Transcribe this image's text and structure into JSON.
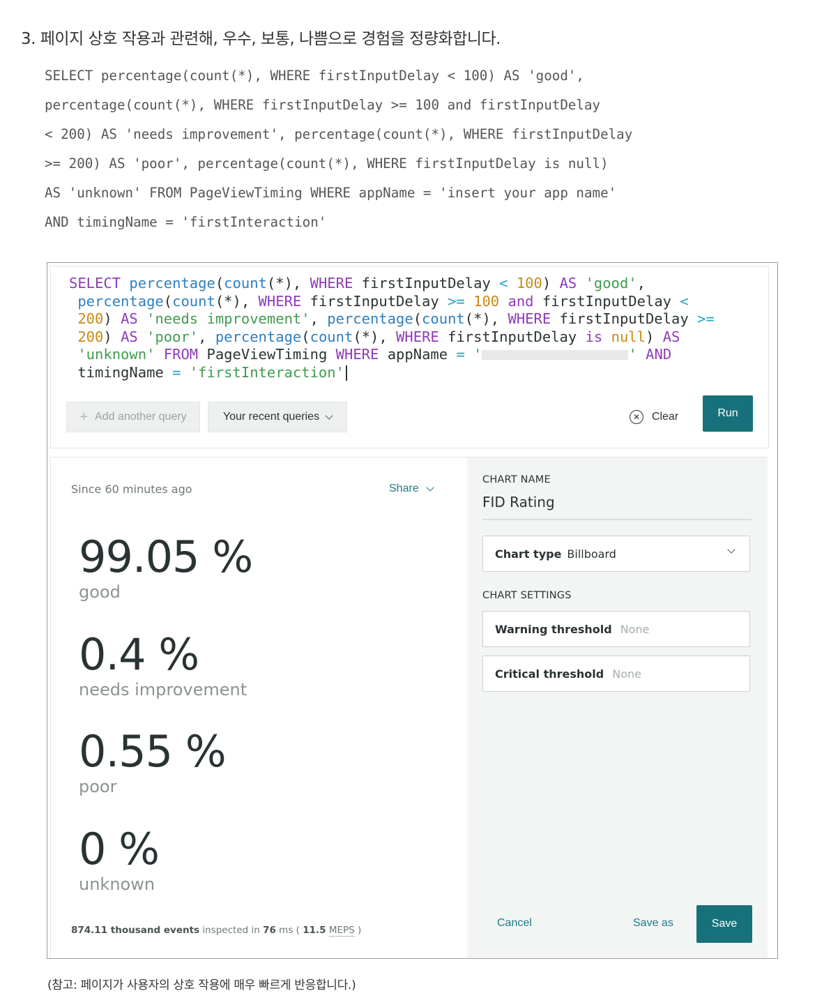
{
  "doc": {
    "step_number": "3.",
    "step_text": "페이지 상호 작용과 관련해, 우수, 보통, 나쁨으로 경험을 정량화합니다.",
    "code_lines": [
      "SELECT percentage(count(*), WHERE firstInputDelay < 100) AS 'good',",
      "percentage(count(*), WHERE firstInputDelay >= 100 and firstInputDelay",
      "< 200) AS 'needs improvement', percentage(count(*), WHERE firstInputDelay",
      ">= 200) AS 'poor', percentage(count(*), WHERE firstInputDelay is null)",
      "AS 'unknown' FROM PageViewTiming WHERE appName = 'insert your app name'",
      "AND timingName = 'firstInteraction'"
    ],
    "note": "(참고: 페이지가 사용자의 상호 작용에 매우 빠르게 반응합니다.)"
  },
  "editor": {
    "query_tokens": {
      "select": "SELECT",
      "percentage": "percentage",
      "count": "count",
      "star_paren": "(*),",
      "where": "WHERE",
      "fid": "firstInputDelay",
      "lt": "<",
      "gte": ">=",
      "n100": "100",
      "n200": "200",
      "as": "AS",
      "good": "'good'",
      "needs": "'needs improvement'",
      "poor": "'poor'",
      "is": "is",
      "null": "null",
      "unknown": "'unknown'",
      "from": "FROM",
      "pvt": "PageViewTiming",
      "appname": "appName",
      "eq": "=",
      "quote": "'",
      "and": "and",
      "AND": "AND",
      "timing": "timingName",
      "first_interaction": "'firstInteraction'"
    },
    "add_query_label": "Add another query",
    "recent_queries_label": "Your recent queries",
    "clear_label": "Clear",
    "run_label": "Run"
  },
  "results": {
    "since": "Since 60 minutes ago",
    "share_label": "Share",
    "metrics": [
      {
        "value": "99.05 %",
        "label": "good"
      },
      {
        "value": "0.4 %",
        "label": "needs improvement"
      },
      {
        "value": "0.55 %",
        "label": "poor"
      },
      {
        "value": "0 %",
        "label": "unknown"
      }
    ],
    "footer": {
      "events": "874.11 thousand events",
      "inspected": "inspected in",
      "ms": "76",
      "ms_unit": "ms (",
      "meps_value": "11.5",
      "meps": "MEPS",
      "close": ")"
    }
  },
  "settings": {
    "chart_name_label": "CHART NAME",
    "chart_name": "FID Rating",
    "chart_type_label": "Chart type",
    "chart_type_value": "Billboard",
    "chart_settings_label": "CHART SETTINGS",
    "warning_label": "Warning threshold",
    "warning_value": "None",
    "critical_label": "Critical threshold",
    "critical_value": "None",
    "cancel_label": "Cancel",
    "save_as_label": "Save as",
    "save_label": "Save"
  },
  "colors": {
    "accent": "#17717a",
    "keyword": "#8f3bb8",
    "function": "#2f7fc0",
    "number": "#c78a12",
    "string": "#3f9c4e"
  }
}
